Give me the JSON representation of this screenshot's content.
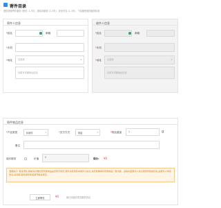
{
  "page": {
    "title": "寄件目录",
    "subtitle": "提供快速寄件服务 (快件, 1-3天) , 按实际服务 (1-3天) , 安全可靠 (1-3天) , 飞毛腿快递的服务标准"
  },
  "sender": {
    "panel_title": "寄件人信息",
    "name_label": "姓名",
    "phone_label": "邮箱",
    "mobile_label": "手机",
    "address_label": "地址",
    "region_placeholder": "请选择",
    "detail_placeholder": "请填写详细地址信息"
  },
  "receiver": {
    "panel_title": "收件人信息",
    "name_label": "姓名",
    "phone_label": "邮箱",
    "mobile_label": "手机",
    "address_label": "地址",
    "region_placeholder": "请选择",
    "detail_placeholder": "请填写详细地址信息"
  },
  "package": {
    "panel_title": "寄件物品信息",
    "type_label": "产品类型",
    "type_value": "标准件",
    "pay_label": "支付方式",
    "pay_value": "现金",
    "weight_label": "物品重量",
    "weight_value": "1",
    "weight_unit": "g",
    "remark_label": "备注",
    "insure_label": "保价服务",
    "insure_value_label": "价值",
    "insure_value": "0",
    "insure_fee_label": "保价:",
    "insure_fee": "¥0",
    "notice": "温馨提示: 寄递须知 寄前请仔细检查所寄物品是否有不规范,寄件请使用原本寄件人信息,请您准确填写所寄物品一致内容。运输中因寄件人信息错误导致的损失,由寄件人承担责任,请谅解,寄件服务承诺遵守相关规定。",
    "submit_label": "立即寄件",
    "total_price": "¥0",
    "agreement": "我已阅读并同意服务协议"
  },
  "colors": {
    "accent": "#2d8cf0",
    "required": "#e4393c",
    "notice_bg": "#fff4e5"
  }
}
